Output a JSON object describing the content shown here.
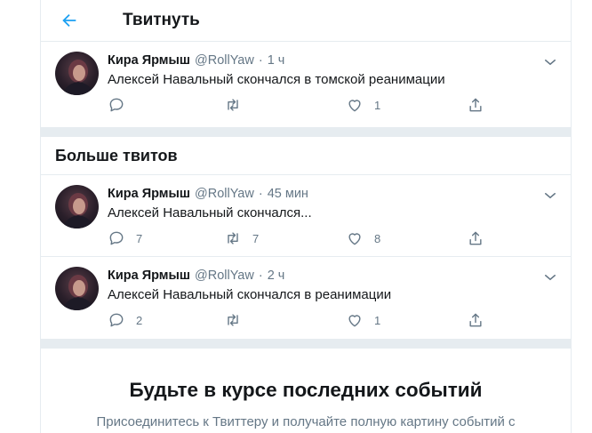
{
  "header": {
    "title": "Твитнуть",
    "back_icon": "arrow-left-icon",
    "accent": "#1da1f2"
  },
  "main_tweet": {
    "name": "Кира Ярмыш",
    "handle": "@RollYaw",
    "separator": "·",
    "time": "1 ч",
    "text": "Алексей Навальный скончался в томской реанимации",
    "replies": "",
    "retweets": "",
    "likes": "1"
  },
  "more_tweets": {
    "title": "Больше твитов",
    "items": [
      {
        "name": "Кира Ярмыш",
        "handle": "@RollYaw",
        "separator": "·",
        "time": "45 мин",
        "text": "Алексей Навальный скончался...",
        "replies": "7",
        "retweets": "7",
        "likes": "8"
      },
      {
        "name": "Кира Ярмыш",
        "handle": "@RollYaw",
        "separator": "·",
        "time": "2 ч",
        "text": "Алексей Навальный скончался в реанимации",
        "replies": "2",
        "retweets": "",
        "likes": "1"
      }
    ]
  },
  "cta": {
    "title": "Будьте в курсе последних событий",
    "subtitle": "Присоединитесь к Твиттеру и получайте полную картину событий с"
  },
  "icons": [
    "arrow-left-icon",
    "chevron-down-icon",
    "reply-icon",
    "retweet-icon",
    "heart-icon",
    "share-icon"
  ],
  "colors": {
    "text": "#14171a",
    "muted": "#657786",
    "border": "#e6ecf0",
    "accent": "#1da1f2"
  }
}
